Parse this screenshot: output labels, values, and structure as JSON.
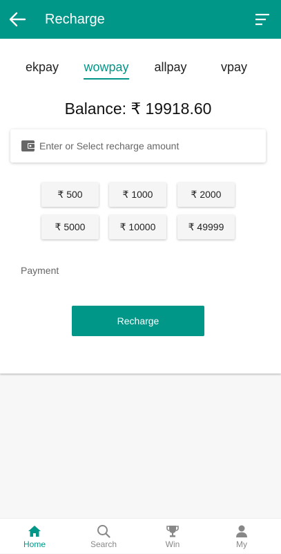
{
  "header": {
    "title": "Recharge",
    "back_icon": "arrow-left-icon",
    "menu_icon": "menu-lines-icon"
  },
  "tabs": [
    {
      "label": "ekpay",
      "active": false
    },
    {
      "label": "wowpay",
      "active": true
    },
    {
      "label": "allpay",
      "active": false
    },
    {
      "label": "vpay",
      "active": false
    }
  ],
  "balance": {
    "text": "Balance: ₹ 19918.60"
  },
  "amount_input": {
    "placeholder": "Enter or Select recharge amount",
    "value": "",
    "icon": "wallet-icon"
  },
  "amount_options": [
    "₹ 500",
    "₹ 1000",
    "₹ 2000",
    "₹ 5000",
    "₹ 10000",
    "₹ 49999"
  ],
  "payment": {
    "label": "Payment"
  },
  "recharge_button": {
    "label": "Recharge"
  },
  "bottom_nav": [
    {
      "label": "Home",
      "icon": "home-icon",
      "active": true
    },
    {
      "label": "Search",
      "icon": "search-icon",
      "active": false
    },
    {
      "label": "Win",
      "icon": "trophy-icon",
      "active": false
    },
    {
      "label": "My",
      "icon": "person-icon",
      "active": false
    }
  ],
  "colors": {
    "primary": "#009688",
    "text": "#222222",
    "muted": "#888888"
  }
}
